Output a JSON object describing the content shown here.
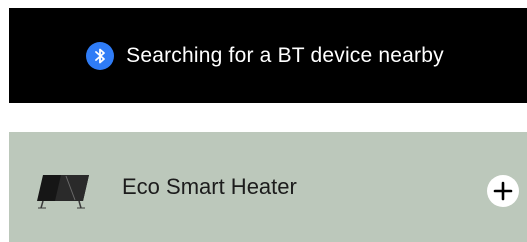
{
  "status_banner": {
    "icon": "bluetooth-icon",
    "text": "Searching for a BT device nearby",
    "accent_color": "#2f7cf6"
  },
  "device_list": [
    {
      "name": "Eco Smart Heater",
      "thumbnail_icon": "heater-panel-icon",
      "action_icon": "plus-icon"
    }
  ],
  "colors": {
    "banner_background": "#000000",
    "row_background": "#bcc8bb"
  }
}
